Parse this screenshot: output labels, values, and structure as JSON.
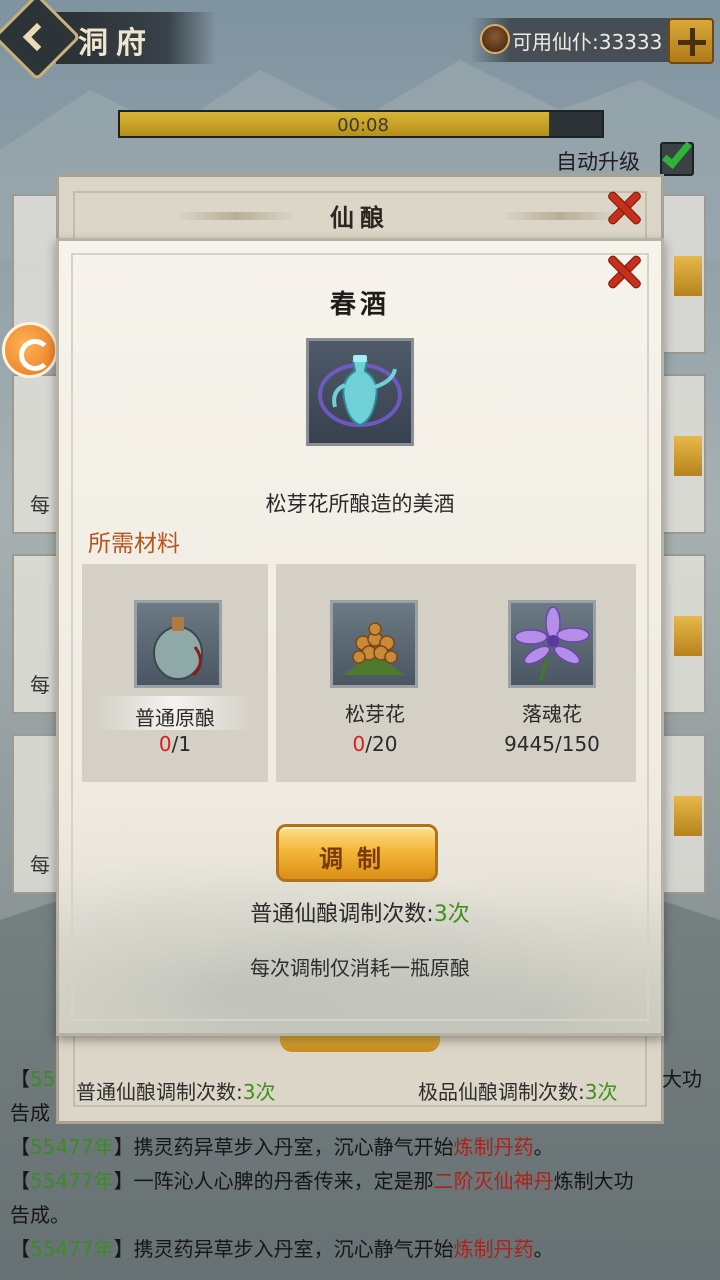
{
  "header": {
    "title": "洞府",
    "resource_text": "可用仙仆:33333"
  },
  "progress": {
    "time": "00:08",
    "fraction": 0.89
  },
  "auto_upgrade": {
    "label": "自动升级",
    "checked": true
  },
  "bg_cards": [
    {
      "label": "每"
    },
    {
      "label": "每"
    },
    {
      "label": "每"
    }
  ],
  "outer_panel": {
    "title": "仙酿",
    "normal_label": "普通仙酿调制次数:",
    "normal_value": "3次",
    "premium_label": "极品仙酿调制次数:",
    "premium_value": "3次"
  },
  "modal": {
    "item_title": "春酒",
    "item_icon": "wine-ewer-icon",
    "description": "松芽花所酿造的美酒",
    "materials_header": "所需材料",
    "materials": [
      {
        "name": "普通原酿",
        "have": "0",
        "need": "/1",
        "icon": "gourd-jar-icon"
      },
      {
        "name": "松芽花",
        "have": "0",
        "need": "/20",
        "icon": "pine-bud-flower-icon"
      },
      {
        "name": "落魂花",
        "have": "9445",
        "need": "/150",
        "icon": "purple-flower-icon"
      }
    ],
    "brew_button": "调制",
    "brew_count_label": "普通仙酿调制次数:",
    "brew_count_value": "3次",
    "note": "每次调制仅消耗一瓶原酿"
  },
  "log": [
    {
      "pre": "【",
      "year": "55",
      "post": "",
      "hidden": true
    },
    {
      "pre": "【",
      "year": "55477年",
      "mid": "】携灵药异草步入丹室，沉心静气开始",
      "red": "炼制丹药",
      "end": "。"
    },
    {
      "pre": "【",
      "year": "55477年",
      "mid": "】一阵沁人心脾的丹香传来，定是那",
      "red": "二阶灭仙神丹",
      "end": "炼制大功"
    },
    {
      "text": "告成。"
    },
    {
      "pre": "【",
      "year": "55477年",
      "mid": "】携灵药异草步入丹室，沉心静气开始",
      "red": "炼制丹药",
      "end": "。"
    }
  ],
  "log_partial": {
    "right_fragment": "大功",
    "second_line": "告成"
  },
  "colors": {
    "accent_gold": "#d9b533",
    "close_red": "#c5301c",
    "year_green": "#3c8a2a",
    "highlight_red": "#b0201a"
  }
}
